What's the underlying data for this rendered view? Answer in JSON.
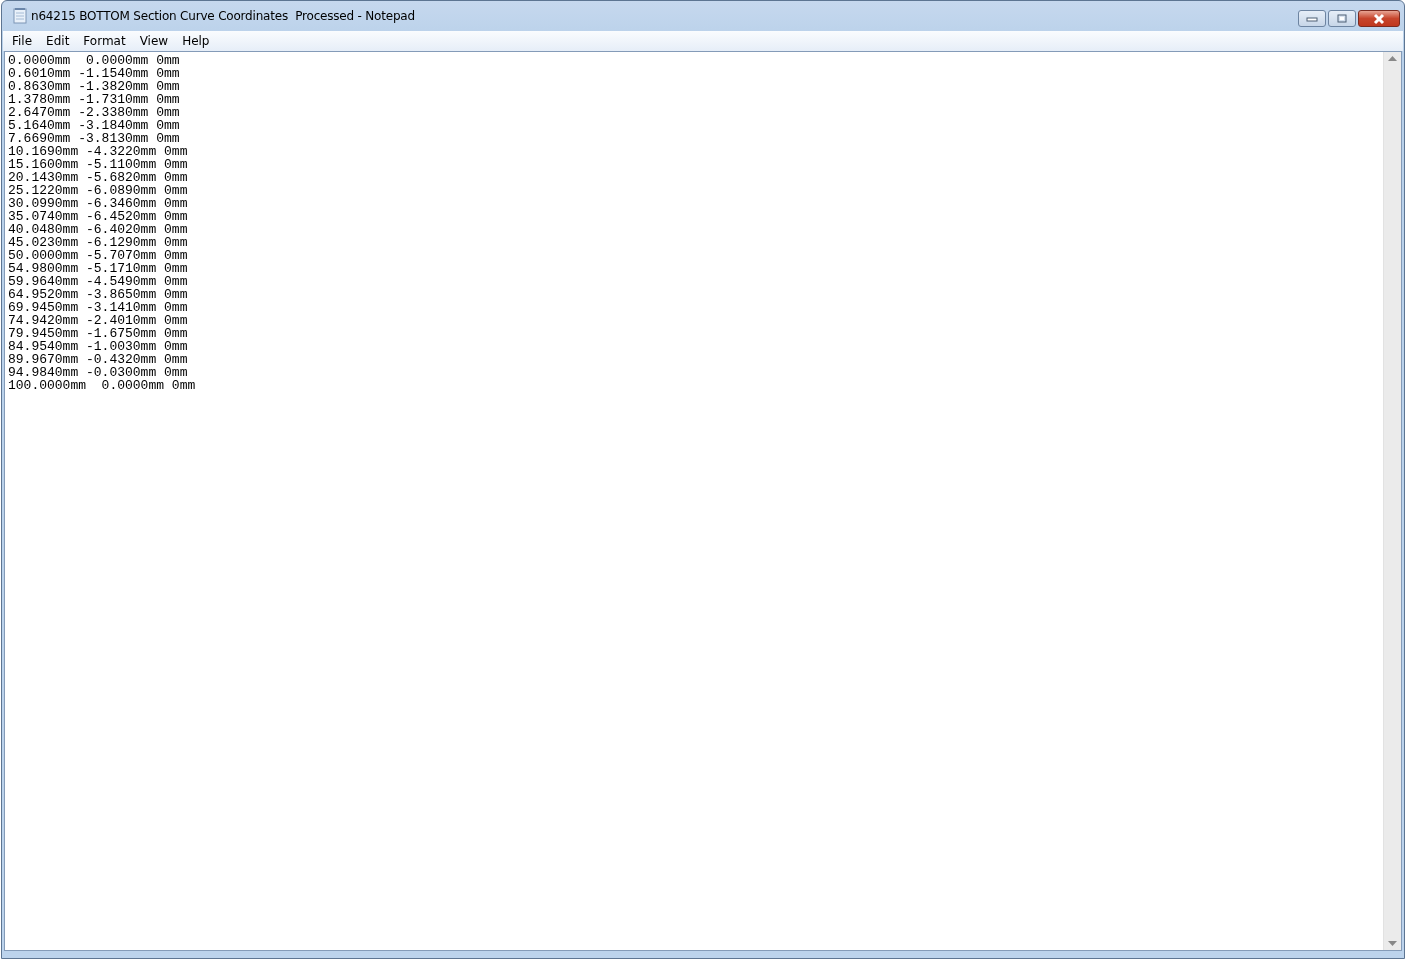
{
  "window": {
    "title": "n64215 BOTTOM Section Curve Coordinates  Processed - Notepad"
  },
  "menu": [
    "File",
    "Edit",
    "Format",
    "View",
    "Help"
  ],
  "document": {
    "lines": [
      "0.0000mm  0.0000mm 0mm",
      "0.6010mm -1.1540mm 0mm",
      "0.8630mm -1.3820mm 0mm",
      "1.3780mm -1.7310mm 0mm",
      "2.6470mm -2.3380mm 0mm",
      "5.1640mm -3.1840mm 0mm",
      "7.6690mm -3.8130mm 0mm",
      "10.1690mm -4.3220mm 0mm",
      "15.1600mm -5.1100mm 0mm",
      "20.1430mm -5.6820mm 0mm",
      "25.1220mm -6.0890mm 0mm",
      "30.0990mm -6.3460mm 0mm",
      "35.0740mm -6.4520mm 0mm",
      "40.0480mm -6.4020mm 0mm",
      "45.0230mm -6.1290mm 0mm",
      "50.0000mm -5.7070mm 0mm",
      "54.9800mm -5.1710mm 0mm",
      "59.9640mm -4.5490mm 0mm",
      "64.9520mm -3.8650mm 0mm",
      "69.9450mm -3.1410mm 0mm",
      "74.9420mm -2.4010mm 0mm",
      "79.9450mm -1.6750mm 0mm",
      "84.9540mm -1.0030mm 0mm",
      "89.9670mm -0.4320mm 0mm",
      "94.9840mm -0.0300mm 0mm",
      "100.0000mm  0.0000mm 0mm"
    ]
  }
}
